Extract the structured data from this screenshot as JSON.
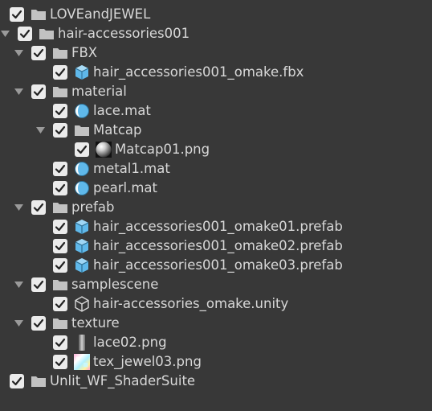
{
  "tree": {
    "items": [
      {
        "label": "LOVEandJEWEL",
        "depth": 0,
        "arrow": false,
        "icon": "folder-icon"
      },
      {
        "label": "hair-accessories001",
        "depth": 0,
        "arrow": true,
        "icon": "folder-icon"
      },
      {
        "label": "FBX",
        "depth": 1,
        "arrow": true,
        "icon": "folder-icon"
      },
      {
        "label": "hair_accessories001_omake.fbx",
        "depth": 2,
        "arrow": false,
        "icon": "model-icon"
      },
      {
        "label": "material",
        "depth": 1,
        "arrow": true,
        "icon": "folder-icon"
      },
      {
        "label": "lace.mat",
        "depth": 2,
        "arrow": false,
        "icon": "material-icon"
      },
      {
        "label": "Matcap",
        "depth": 2,
        "arrow": true,
        "icon": "folder-icon"
      },
      {
        "label": "Matcap01.png",
        "depth": 3,
        "arrow": false,
        "icon": "matcap-texture-icon"
      },
      {
        "label": "metal1.mat",
        "depth": 2,
        "arrow": false,
        "icon": "material-icon"
      },
      {
        "label": "pearl.mat",
        "depth": 2,
        "arrow": false,
        "icon": "material-icon"
      },
      {
        "label": "prefab",
        "depth": 1,
        "arrow": true,
        "icon": "folder-icon"
      },
      {
        "label": "hair_accessories001_omake01.prefab",
        "depth": 2,
        "arrow": false,
        "icon": "prefab-icon"
      },
      {
        "label": "hair_accessories001_omake02.prefab",
        "depth": 2,
        "arrow": false,
        "icon": "prefab-icon"
      },
      {
        "label": "hair_accessories001_omake03.prefab",
        "depth": 2,
        "arrow": false,
        "icon": "prefab-icon"
      },
      {
        "label": "samplescene",
        "depth": 1,
        "arrow": true,
        "icon": "folder-icon"
      },
      {
        "label": "hair-accessories_omake.unity",
        "depth": 2,
        "arrow": false,
        "icon": "unity-scene-icon"
      },
      {
        "label": "texture",
        "depth": 1,
        "arrow": true,
        "icon": "folder-icon"
      },
      {
        "label": "lace02.png",
        "depth": 2,
        "arrow": false,
        "icon": "lace-texture-icon"
      },
      {
        "label": "tex_jewel03.png",
        "depth": 2,
        "arrow": false,
        "icon": "jewel-texture-icon"
      },
      {
        "label": "Unlit_WF_ShaderSuite",
        "depth": 0,
        "arrow": false,
        "icon": "folder-icon"
      }
    ]
  },
  "colors": {
    "background": "#383838",
    "text": "#d8d8d8",
    "checkbox": "#ebebeb",
    "checkmark": "#222222",
    "folder": "#c2c2c2",
    "asset_blue": "#5fb8ea"
  }
}
